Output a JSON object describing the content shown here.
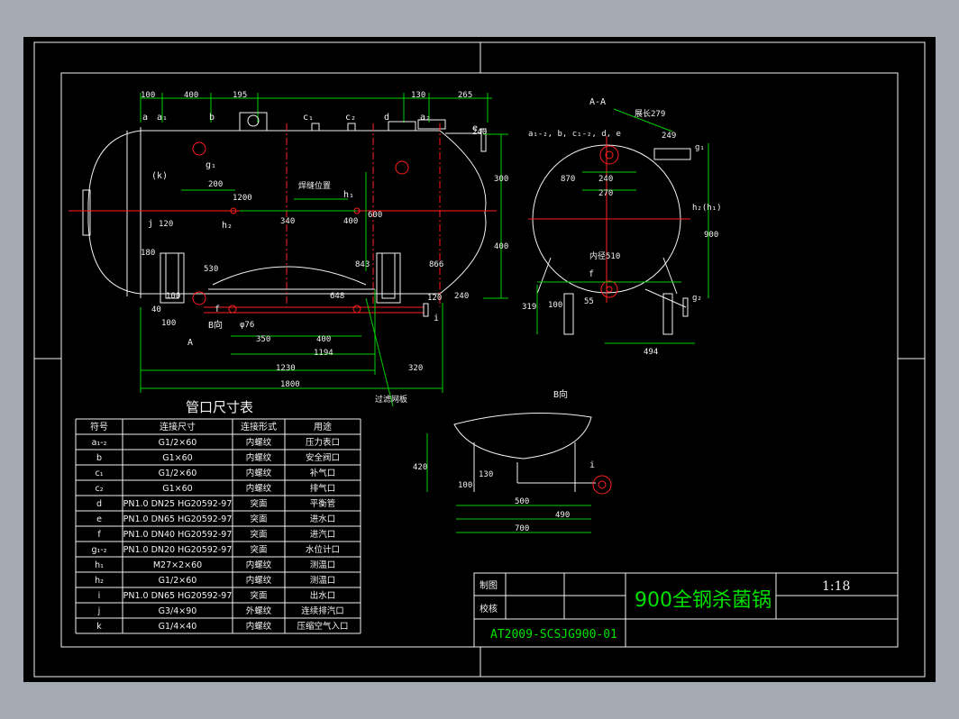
{
  "drawing": {
    "title": "900全钢杀菌锅",
    "scale": "1:18",
    "drawing_number": "AT2009-SCSJG900-01",
    "title_block_labels": [
      "制图",
      "校核"
    ]
  },
  "section_labels": {
    "section_aa": "A-A",
    "view_b": "B向",
    "view_b_marker": "B向",
    "section_a_marker": "A"
  },
  "front_view": {
    "top_dims": [
      "100",
      "400",
      "195",
      "130",
      "265"
    ],
    "nozzle_labels": [
      "a",
      "a₁",
      "b",
      "c₁",
      "c₂",
      "d",
      "a₂",
      "e",
      "g₁",
      "(k)",
      "j",
      "h₁",
      "h₂",
      "f",
      "i",
      "焊缝位置",
      "过滤网板"
    ],
    "inner_dims": [
      "200",
      "1200",
      "340",
      "400",
      "120",
      "180",
      "40",
      "100",
      "350",
      "400",
      "1194",
      "300",
      "600",
      "400",
      "530",
      "240",
      "120",
      "240",
      "100",
      "648",
      "843",
      "866",
      "φ76"
    ],
    "bottom_dims": [
      "1230",
      "320",
      "1800"
    ]
  },
  "section_view": {
    "labels": [
      "a₁-₂, b, c₁-₂, d, e",
      "展长279",
      "g₁",
      "h₂(h₁)",
      "f",
      "g₂",
      "内径510"
    ],
    "dims": [
      "249",
      "240",
      "270",
      "870",
      "900",
      "319",
      "100",
      "55",
      "494"
    ]
  },
  "b_view": {
    "labels": [
      "i"
    ],
    "dims": [
      "420",
      "100",
      "500",
      "490",
      "700",
      "130"
    ]
  },
  "nozzle_table": {
    "title": "管口尺寸表",
    "headers": [
      "符号",
      "连接尺寸",
      "连接形式",
      "用途"
    ],
    "rows": [
      [
        "a₁-₂",
        "G1/2×60",
        "内螺纹",
        "压力表口"
      ],
      [
        "b",
        "G1×60",
        "内螺纹",
        "安全阀口"
      ],
      [
        "c₁",
        "G1/2×60",
        "内螺纹",
        "补气口"
      ],
      [
        "c₂",
        "G1×60",
        "内螺纹",
        "排气口"
      ],
      [
        "d",
        "PN1.0 DN25 HG20592-97",
        "突面",
        "平衡管"
      ],
      [
        "e",
        "PN1.0 DN65 HG20592-97",
        "突面",
        "进水口"
      ],
      [
        "f",
        "PN1.0 DN40 HG20592-97",
        "突面",
        "进汽口"
      ],
      [
        "g₁-₂",
        "PN1.0 DN20 HG20592-97",
        "突面",
        "水位计口"
      ],
      [
        "h₁",
        "M27×2×60",
        "内螺纹",
        "测温口"
      ],
      [
        "h₂",
        "G1/2×60",
        "内螺纹",
        "测温口"
      ],
      [
        "i",
        "PN1.0 DN65 HG20592-97",
        "突面",
        "出水口"
      ],
      [
        "j",
        "G3/4×90",
        "外螺纹",
        "连续排汽口"
      ],
      [
        "k",
        "G1/4×40",
        "内螺纹",
        "压缩空气入口"
      ]
    ]
  }
}
